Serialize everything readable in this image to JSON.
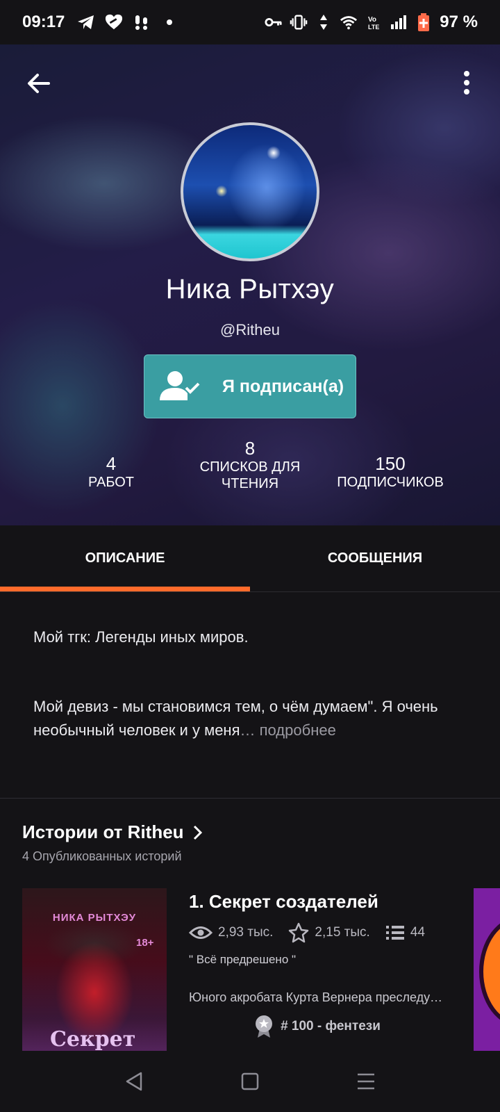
{
  "status_bar": {
    "time": "09:17",
    "battery": "97 %",
    "icons": [
      "telegram-icon",
      "heart-icon",
      "notification-icon",
      "dot-icon",
      "key-icon",
      "vibrate-icon",
      "data-arrows-icon",
      "wifi-icon",
      "volte-icon",
      "signal-icon",
      "battery-icon"
    ]
  },
  "profile": {
    "name": "Ника Рытхэу",
    "handle": "@Ritheu",
    "follow_label": "Я подписан(а)",
    "accent_color": "#3a9ea2"
  },
  "stats": {
    "works": {
      "value": "4",
      "label": "РАБОТ"
    },
    "reading_lists": {
      "value": "8",
      "label": "СПИСКОВ ДЛЯ ЧТЕНИЯ"
    },
    "followers": {
      "value": "150",
      "label": "ПОДПИСЧИКОВ"
    }
  },
  "tabs": {
    "description": "ОПИСАНИЕ",
    "messages": "СООБЩЕНИЯ",
    "active_color": "#ff6b2b"
  },
  "description": {
    "line1": "Мой тгк: Легенды иных миров.",
    "line2": "Мой девиз - мы становимся тем, о чём думаем\". Я очень необычный человек и у меня",
    "ellipsis": "…",
    "more": "подробнее"
  },
  "stories": {
    "title": "Истории от Ritheu",
    "subtitle": "4 Опубликованных историй",
    "items": [
      {
        "title": "1. Секрет создателей",
        "reads": "2,93 тыс.",
        "votes": "2,15 тыс.",
        "parts": "44",
        "tagline": "\" Всё предрешено \"",
        "description": "Юного акробата Курта Вернера преследует загадочная тень",
        "rank": "# 100 - фентези",
        "cover_author": "НИКА РЫТХЭУ",
        "cover_age": "18+",
        "cover_title": "Секрет"
      }
    ]
  }
}
